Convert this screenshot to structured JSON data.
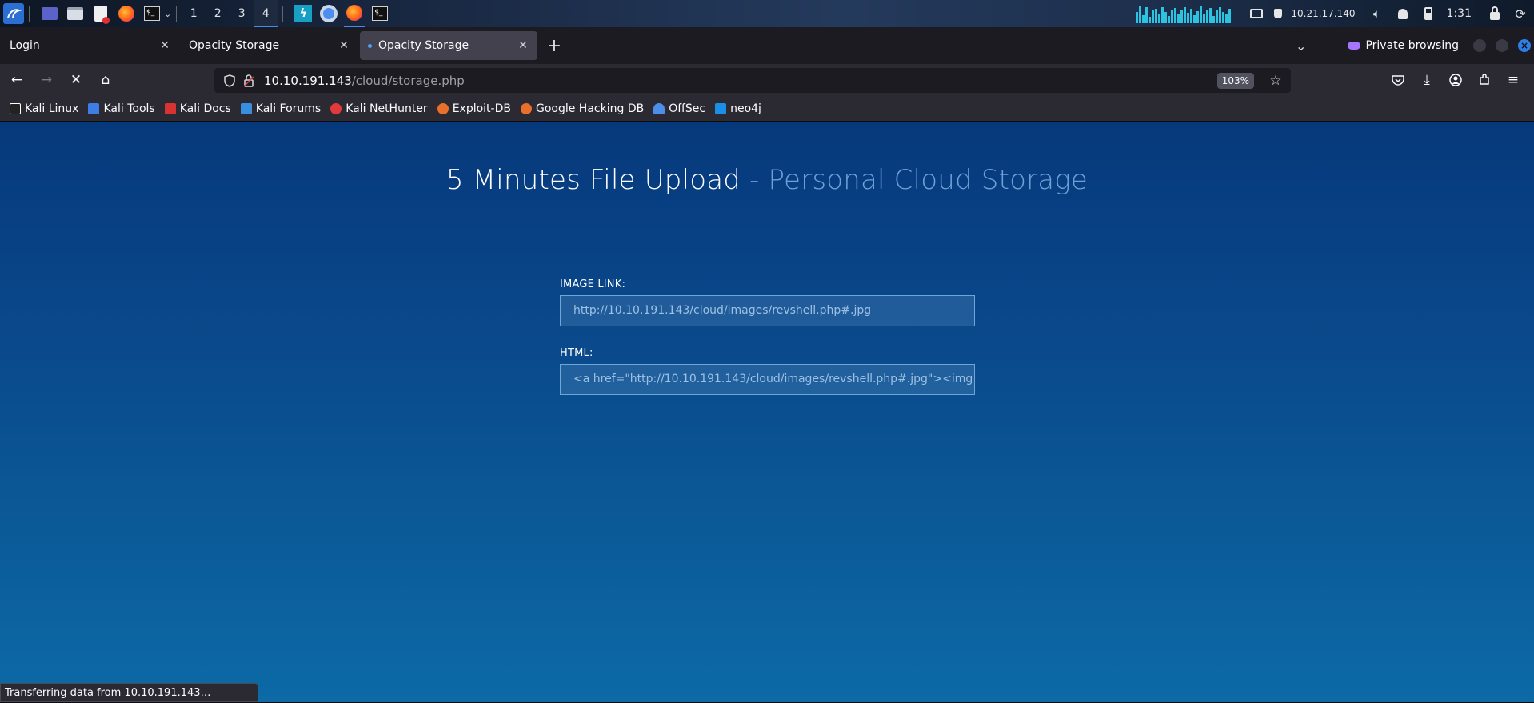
{
  "taskbar": {
    "workspaces": [
      "1",
      "2",
      "3",
      "4"
    ],
    "active_workspace": "4",
    "ip": "10.21.17.140",
    "clock": "1:31"
  },
  "tabs": [
    {
      "title": "Login",
      "active": false
    },
    {
      "title": "Opacity Storage",
      "active": false
    },
    {
      "title": "Opacity Storage",
      "active": true
    }
  ],
  "tabstrip": {
    "private_label": "Private browsing"
  },
  "navbar": {
    "url_host": "10.10.191.143",
    "url_path": "/cloud/storage.php",
    "zoom": "103%"
  },
  "bookmarks": [
    {
      "label": "Kali Linux",
      "icon": "kali-dragon-icon",
      "color": "#ffffff"
    },
    {
      "label": "Kali Tools",
      "icon": "kali-tools-icon",
      "color": "#3d7ee6"
    },
    {
      "label": "Kali Docs",
      "icon": "kali-docs-icon",
      "color": "#d83232"
    },
    {
      "label": "Kali Forums",
      "icon": "kali-forums-icon",
      "color": "#3a8ee0"
    },
    {
      "label": "Kali NetHunter",
      "icon": "nethunter-icon",
      "color": "#e03a3a"
    },
    {
      "label": "Exploit-DB",
      "icon": "exploit-db-icon",
      "color": "#e8702a"
    },
    {
      "label": "Google Hacking DB",
      "icon": "ghdb-icon",
      "color": "#e8702a"
    },
    {
      "label": "OffSec",
      "icon": "offsec-icon",
      "color": "#4c8ee8"
    },
    {
      "label": "neo4j",
      "icon": "neo4j-icon",
      "color": "#1a8fe8"
    }
  ],
  "page": {
    "title_main": "5 Minutes File Upload",
    "title_sub": " - Personal Cloud Storage",
    "image_link_label": "IMAGE LINK:",
    "image_link_value": "http://10.10.191.143/cloud/images/revshell.php#.jpg",
    "html_label": "HTML:",
    "html_value": "<a href=\"http://10.10.191.143/cloud/images/revshell.php#.jpg\"><img"
  },
  "status": "Transferring data from 10.10.191.143…"
}
